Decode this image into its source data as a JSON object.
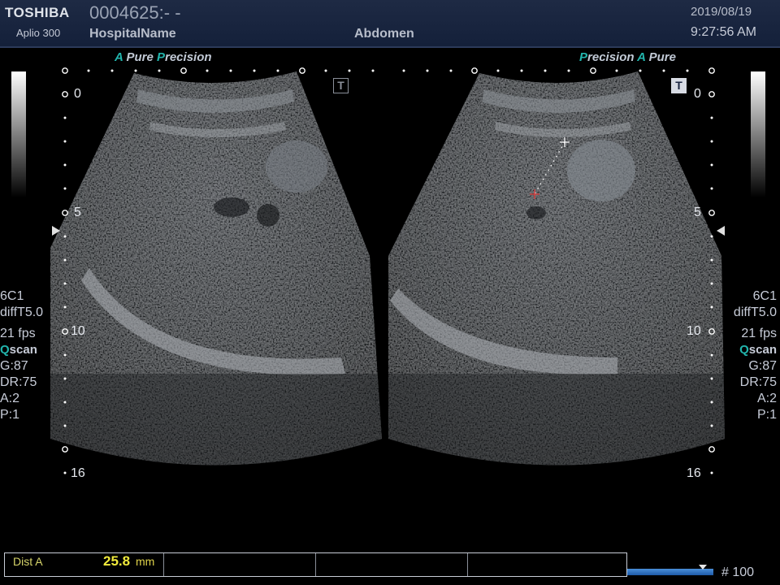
{
  "header": {
    "brand": "TOSHIBA",
    "model": "Aplio 300",
    "patient_id": "0004625:- -",
    "hospital": "HospitalName",
    "exam": "Abdomen",
    "date": "2019/08/19",
    "time": "9:27:56 AM"
  },
  "left_panel": {
    "tag_a": "A",
    "tag_pure": "Pure",
    "tag_p": "P",
    "tag_recision": "recision",
    "depth": [
      "0",
      "5",
      "10",
      "16"
    ],
    "t_icon": "T"
  },
  "right_panel": {
    "tag_p": "P",
    "tag_recision": "recision",
    "tag_a": "A",
    "tag_pure": "Pure",
    "depth": [
      "0",
      "5",
      "10",
      "16"
    ],
    "t_icon": "T"
  },
  "left_params": {
    "probe": "6C1",
    "mode": "diffT5.0",
    "fps": "21 fps",
    "qscan_q": "Q",
    "qscan_rest": "scan",
    "gain": "G:87",
    "dr": "DR:75",
    "a": "A:2",
    "p": "P:1"
  },
  "right_params": {
    "probe": "6C1",
    "mode": "diffT5.0",
    "fps": "21 fps",
    "qscan_q": "Q",
    "qscan_rest": "scan",
    "gain": "G:87",
    "dr": "DR:75",
    "a": "A:2",
    "p": "P:1"
  },
  "measurement": {
    "label": "Dist A",
    "value": "25.8",
    "unit": "mm"
  },
  "frame_counter": "# 100",
  "colors": {
    "accent": "#22b5ad",
    "measure_value": "#f0ea3c",
    "header_bg": "#1a2640"
  }
}
